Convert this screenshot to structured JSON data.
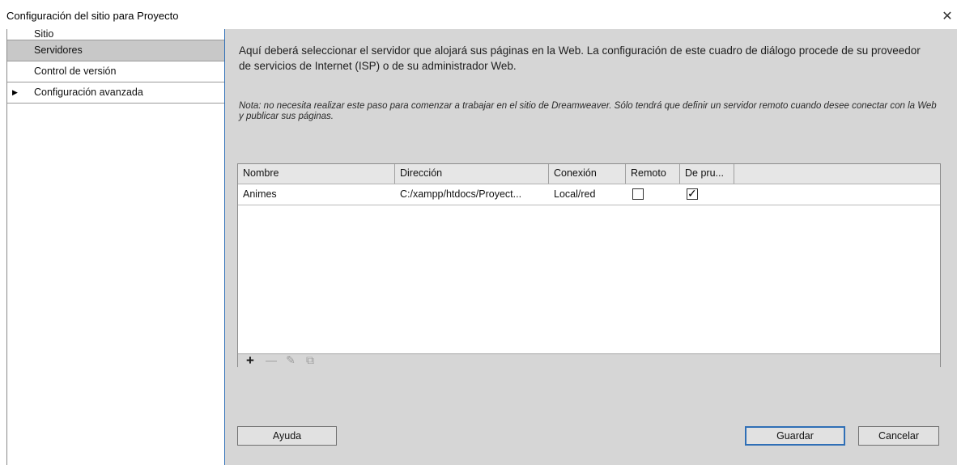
{
  "window": {
    "title": "Configuración del sitio para Proyecto",
    "close_glyph": "✕"
  },
  "sidebar": {
    "items": [
      {
        "label": "Sitio",
        "active": false
      },
      {
        "label": "Servidores",
        "active": true
      },
      {
        "label": "Control de versión",
        "active": false
      },
      {
        "label": "Configuración avanzada",
        "active": false,
        "expandable": true
      }
    ],
    "expand_arrow": "▶"
  },
  "content": {
    "intro": "Aquí deberá seleccionar el servidor que alojará sus páginas en la Web. La configuración de este cuadro de diálogo procede de su proveedor de servicios de Internet (ISP) o de su administrador Web.",
    "note": "Nota: no necesita realizar este paso para comenzar a trabajar en el sitio de Dreamweaver. Sólo tendrá que definir un servidor remoto cuando desee conectar con la Web y publicar sus páginas."
  },
  "table": {
    "columns": [
      "Nombre",
      "Dirección",
      "Conexión",
      "Remoto",
      "De pru..."
    ],
    "rows": [
      {
        "nombre": "Animes",
        "direccion": "C:/xampp/htdocs/Proyect...",
        "conexion": "Local/red",
        "remoto": false,
        "de_prueba": true
      }
    ],
    "checkmark_glyph": "✓"
  },
  "toolbar": {
    "add_glyph": "+",
    "remove_glyph": "—",
    "edit_glyph": "✎",
    "duplicate_glyph": "⧉"
  },
  "buttons": {
    "help": "Ayuda",
    "save": "Guardar",
    "cancel": "Cancelar"
  }
}
